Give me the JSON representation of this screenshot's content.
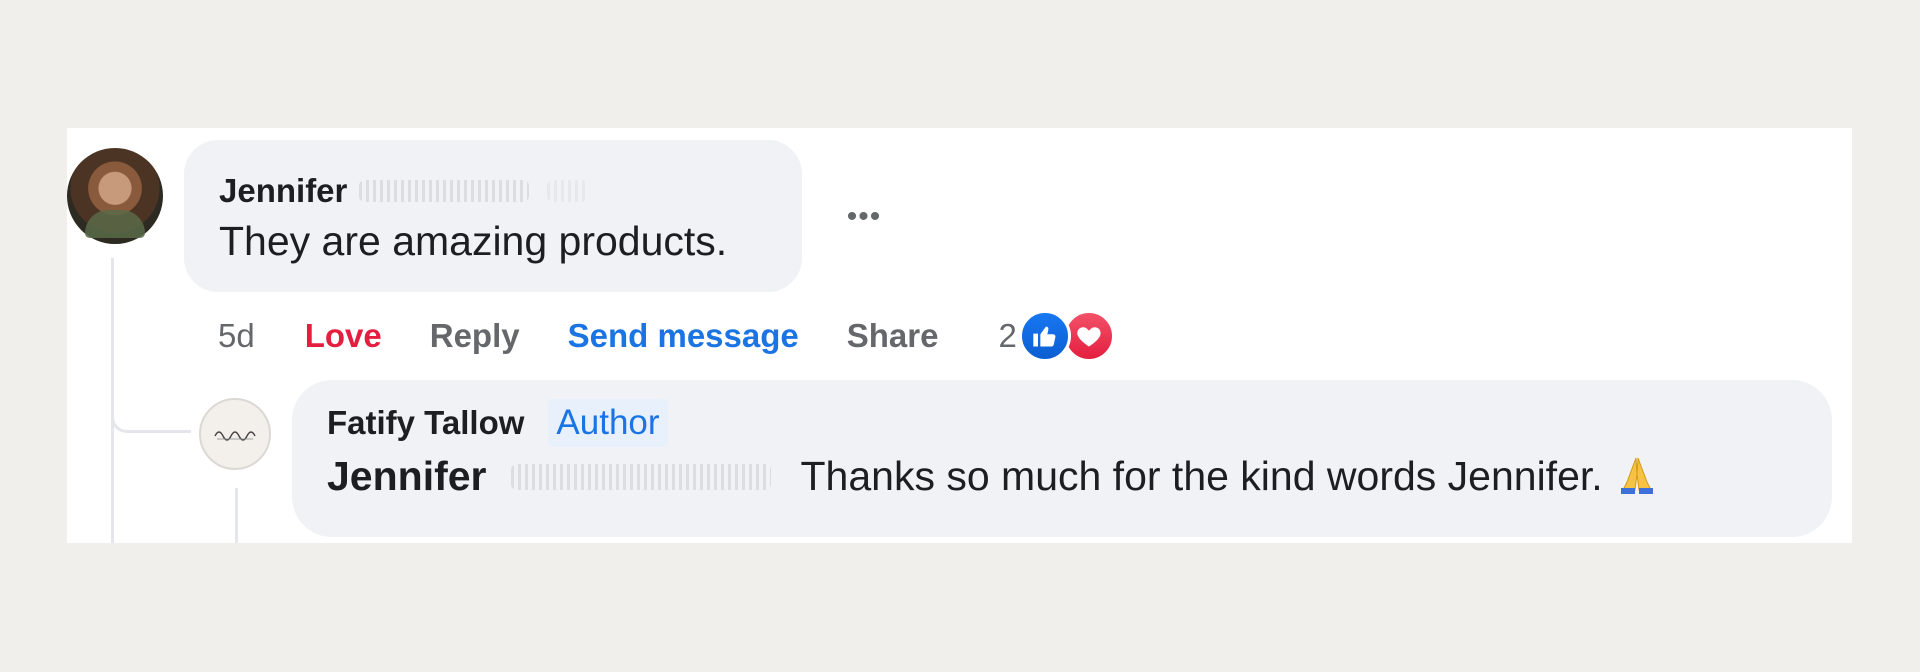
{
  "comment": {
    "author": "Jennifer",
    "text": "They are amazing products.",
    "more_label": "•••",
    "avatar_icon": "user-photo-avatar"
  },
  "actions": {
    "time": "5d",
    "love": "Love",
    "reply": "Reply",
    "send_message": "Send message",
    "share": "Share",
    "reaction_count": "2",
    "reaction_icons": [
      "like-icon",
      "heart-icon"
    ]
  },
  "reply": {
    "page_name": "Fatify Tallow",
    "badge": "Author",
    "tagged_name": "Jennifer",
    "text": "Thanks so much for the kind words Jennifer.",
    "emoji_icon": "folded-hands-icon"
  },
  "colors": {
    "love": "#e41e3f",
    "link_blue": "#1b74e4",
    "bubble": "#f0f2f5"
  }
}
